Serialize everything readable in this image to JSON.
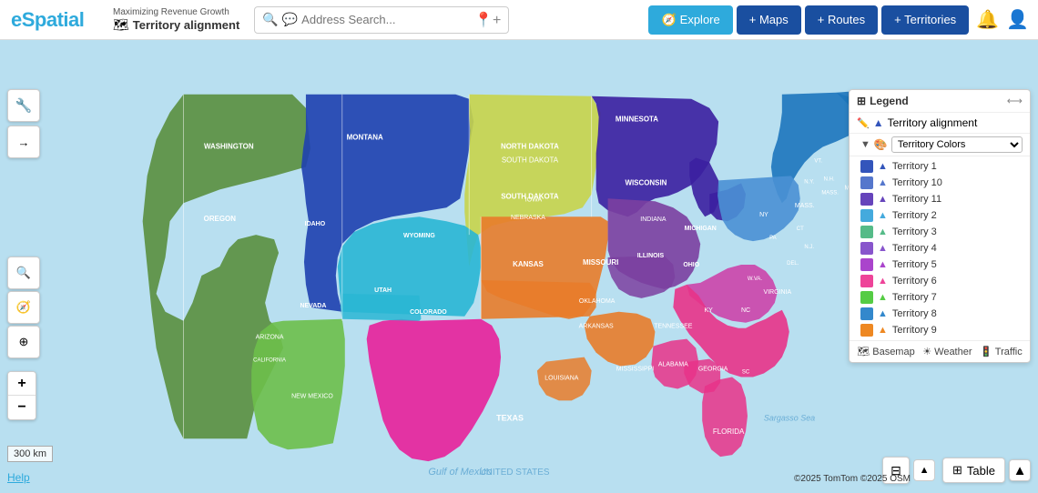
{
  "header": {
    "logo": "eSpatial",
    "project_name": "Maximizing Revenue Growth",
    "map_icon": "🗺",
    "map_name": "Territory alignment",
    "search_placeholder": "Address Search...",
    "nav": {
      "explore_label": "Explore",
      "maps_label": "+ Maps",
      "routes_label": "+ Routes",
      "territories_label": "+ Territories"
    }
  },
  "legend": {
    "title": "Legend",
    "expand_icon": "⟷",
    "sublayer_label": "Territory alignment",
    "colors_dropdown": "Territory Colors",
    "territories": [
      {
        "id": 1,
        "label": "Territory 1",
        "color": "#3355bb"
      },
      {
        "id": 10,
        "label": "Territory 10",
        "color": "#5577cc"
      },
      {
        "id": 11,
        "label": "Territory 11",
        "color": "#6644bb"
      },
      {
        "id": 2,
        "label": "Territory 2",
        "color": "#44aadd"
      },
      {
        "id": 3,
        "label": "Territory 3",
        "color": "#55bb88"
      },
      {
        "id": 4,
        "label": "Territory 4",
        "color": "#8855cc"
      },
      {
        "id": 5,
        "label": "Territory 5",
        "color": "#aa44cc"
      },
      {
        "id": 6,
        "label": "Territory 6",
        "color": "#ee4499"
      },
      {
        "id": 7,
        "label": "Territory 7",
        "color": "#55cc44"
      },
      {
        "id": 8,
        "label": "Territory 8",
        "color": "#3388cc"
      },
      {
        "id": 9,
        "label": "Territory 9",
        "color": "#ee8822"
      }
    ],
    "basemap_label": "Basemap",
    "weather_label": "Weather",
    "traffic_label": "Traffic"
  },
  "toolbar": {
    "tool_icon": "🔧",
    "arrow_icon": "→"
  },
  "map": {
    "attribution": "©2025 TomTom  ©2025 OSM"
  },
  "scale": {
    "label": "300 km"
  },
  "footer": {
    "help_label": "Help"
  },
  "table_btn": {
    "label": "Table"
  },
  "zoom": {
    "in": "+",
    "out": "−"
  }
}
